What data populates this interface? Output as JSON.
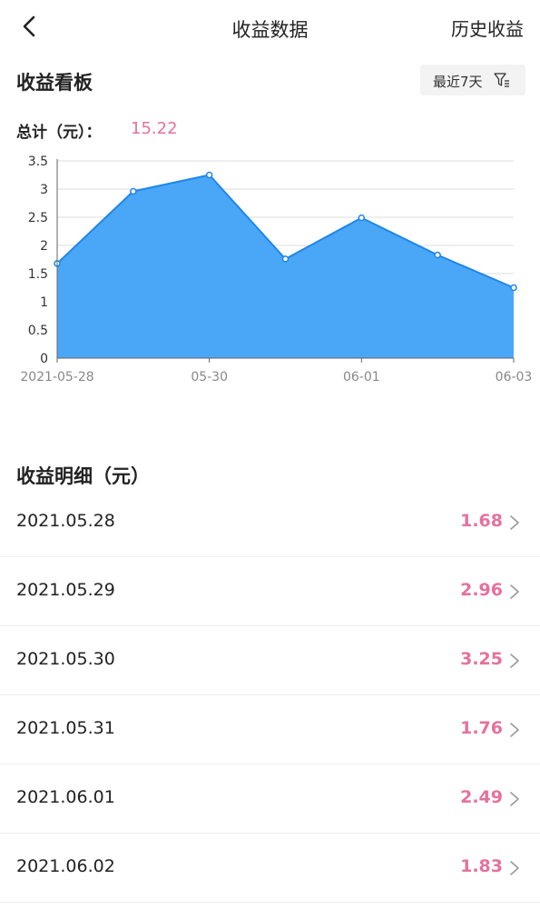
{
  "header": {
    "title": "收益数据",
    "right_link": "历史收益",
    "back_icon": "chevron-left-icon"
  },
  "board": {
    "title": "收益看板",
    "filter_label": "最近7天",
    "filter_icon": "filter-icon"
  },
  "total": {
    "label": "总计（元）：",
    "value": "15.22"
  },
  "chart_data": {
    "type": "area",
    "x": [
      "2021-05-28",
      "05-29",
      "05-30",
      "05-31",
      "06-01",
      "06-02",
      "06-03"
    ],
    "values": [
      1.68,
      2.96,
      3.25,
      1.76,
      2.49,
      1.83,
      1.25
    ],
    "x_tick_labels": [
      "2021-05-28",
      "05-30",
      "06-01",
      "06-03"
    ],
    "y_ticks": [
      "0",
      "0.5",
      "1",
      "1.5",
      "2",
      "2.5",
      "3",
      "3.5"
    ],
    "ylim": [
      0,
      3.5
    ],
    "grid": true,
    "color": "#4aa7f7",
    "line_color": "#1f86e8"
  },
  "detail": {
    "title": "收益明细（元）",
    "rows": [
      {
        "date": "2021.05.28",
        "value": "1.68"
      },
      {
        "date": "2021.05.29",
        "value": "2.96"
      },
      {
        "date": "2021.05.30",
        "value": "3.25"
      },
      {
        "date": "2021.05.31",
        "value": "1.76"
      },
      {
        "date": "2021.06.01",
        "value": "2.49"
      },
      {
        "date": "2021.06.02",
        "value": "1.83"
      }
    ]
  },
  "colors": {
    "accent": "#e5719d",
    "chart_fill": "#4aa7f7"
  }
}
